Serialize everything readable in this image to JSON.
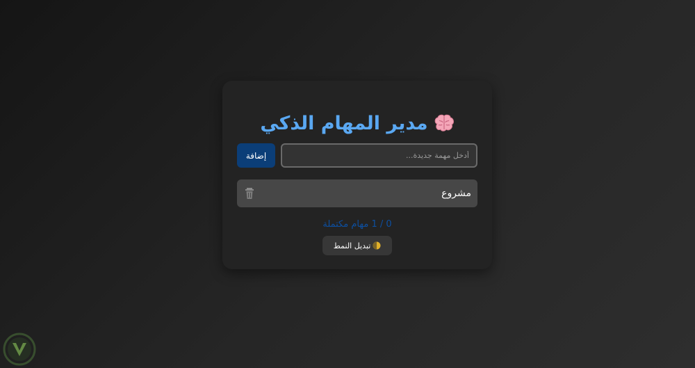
{
  "app": {
    "title": "مدير المهام الذكي",
    "title_icon": "brain-icon"
  },
  "input": {
    "placeholder": "أدخل مهمة جديدة...",
    "value": ""
  },
  "add_button": {
    "label": "إضافة"
  },
  "tasks": [
    {
      "text": "مشروع",
      "delete_icon": "trash-icon"
    }
  ],
  "progress": {
    "text": "0 / 1 مهام مكتملة",
    "completed": 0,
    "total": 1
  },
  "toggle_button": {
    "label": "تبديل النمط",
    "icon": "moon-icon"
  },
  "colors": {
    "accent": "#5aa8f2",
    "button": "#0b3e78",
    "progress": "#0d4fa0",
    "card": "#232323",
    "task": "#474747"
  }
}
